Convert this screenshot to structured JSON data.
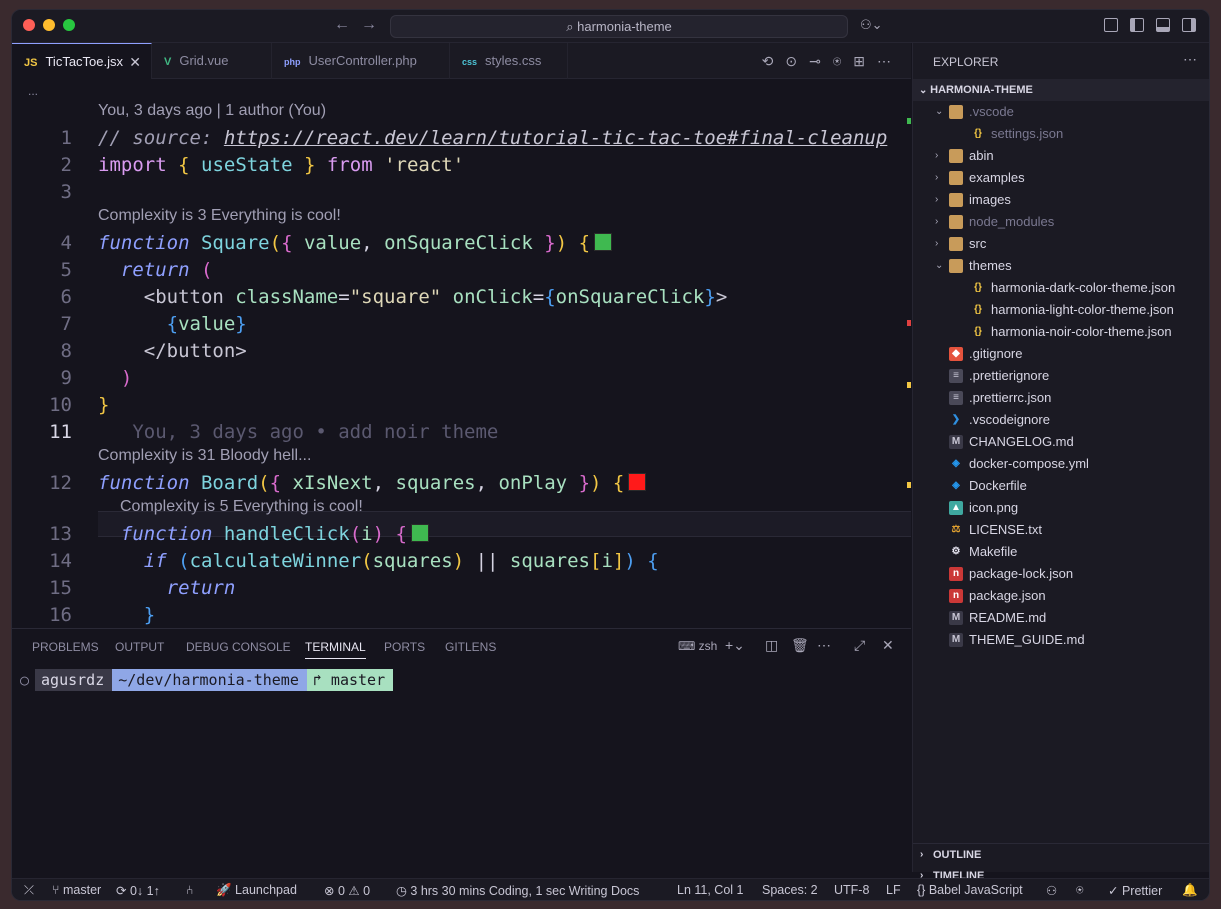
{
  "window": {
    "search": "harmonia-theme"
  },
  "tabs": [
    {
      "label": "TicTacToe.jsx",
      "icon": "JS"
    },
    {
      "label": "Grid.vue",
      "icon": "V"
    },
    {
      "label": "UserController.php",
      "icon": "php"
    },
    {
      "label": "styles.css",
      "icon": "css"
    }
  ],
  "breadcrumb": "...",
  "editor": {
    "lens_author": "You, 3 days ago | 1 author (You)",
    "lens_square": "Complexity is 3 Everything is cool!",
    "lens_board": "Complexity is 31 Bloody hell...",
    "lens_click": "Complexity is 5 Everything is cool!",
    "blame": "You, 3 days ago • add noir theme",
    "line_numbers": [
      "1",
      "2",
      "3",
      "4",
      "5",
      "6",
      "7",
      "8",
      "9",
      "10",
      "11",
      "12",
      "13",
      "14",
      "15",
      "16"
    ],
    "comment_prefix": "// source: ",
    "comment_url": "https://react.dev/learn/tutorial-tic-tac-toe#final-cleanup",
    "colors": {
      "cool": "#3fb950",
      "bad": "#ff1a1a"
    }
  },
  "panel": {
    "tabs": [
      "PROBLEMS",
      "OUTPUT",
      "DEBUG CONSOLE",
      "TERMINAL",
      "PORTS",
      "GITLENS"
    ],
    "shell": "zsh",
    "prompt_user": "agusrdz",
    "prompt_path": "~/dev/harmonia-theme",
    "prompt_branch": "↱ master"
  },
  "sidebar": {
    "title": "EXPLORER",
    "project": "HARMONIA-THEME",
    "items": [
      {
        "label": ".vscode",
        "depth": 1,
        "type": "folder-open",
        "dim": true
      },
      {
        "label": "settings.json",
        "depth": 2,
        "type": "json",
        "dim": true
      },
      {
        "label": "abin",
        "depth": 1,
        "type": "folder"
      },
      {
        "label": "examples",
        "depth": 1,
        "type": "folder"
      },
      {
        "label": "images",
        "depth": 1,
        "type": "folder"
      },
      {
        "label": "node_modules",
        "depth": 1,
        "type": "folder",
        "dim": true
      },
      {
        "label": "src",
        "depth": 1,
        "type": "folder"
      },
      {
        "label": "themes",
        "depth": 1,
        "type": "folder-open"
      },
      {
        "label": "harmonia-dark-color-theme.json",
        "depth": 2,
        "type": "json"
      },
      {
        "label": "harmonia-light-color-theme.json",
        "depth": 2,
        "type": "json"
      },
      {
        "label": "harmonia-noir-color-theme.json",
        "depth": 2,
        "type": "json"
      },
      {
        "label": ".gitignore",
        "depth": 1,
        "type": "git"
      },
      {
        "label": ".prettierignore",
        "depth": 1,
        "type": "file"
      },
      {
        "label": ".prettierrc.json",
        "depth": 1,
        "type": "file"
      },
      {
        "label": ".vscodeignore",
        "depth": 1,
        "type": "vscode"
      },
      {
        "label": "CHANGELOG.md",
        "depth": 1,
        "type": "md"
      },
      {
        "label": "docker-compose.yml",
        "depth": 1,
        "type": "docker"
      },
      {
        "label": "Dockerfile",
        "depth": 1,
        "type": "docker"
      },
      {
        "label": "icon.png",
        "depth": 1,
        "type": "image"
      },
      {
        "label": "LICENSE.txt",
        "depth": 1,
        "type": "license"
      },
      {
        "label": "Makefile",
        "depth": 1,
        "type": "make"
      },
      {
        "label": "package-lock.json",
        "depth": 1,
        "type": "npm"
      },
      {
        "label": "package.json",
        "depth": 1,
        "type": "npm"
      },
      {
        "label": "README.md",
        "depth": 1,
        "type": "md"
      },
      {
        "label": "THEME_GUIDE.md",
        "depth": 1,
        "type": "md"
      }
    ],
    "outline": "OUTLINE",
    "timeline": "TIMELINE"
  },
  "status": {
    "branch": "master",
    "sync": "0↓ 1↑",
    "launchpad": "Launchpad",
    "errors": "0",
    "warnings": "0",
    "coding": "3 hrs 30 mins Coding, 1 sec Writing Docs",
    "position": "Ln 11, Col 1",
    "spaces": "Spaces: 2",
    "encoding": "UTF-8",
    "eol": "LF",
    "language": "Babel JavaScript",
    "prettier": "Prettier"
  }
}
